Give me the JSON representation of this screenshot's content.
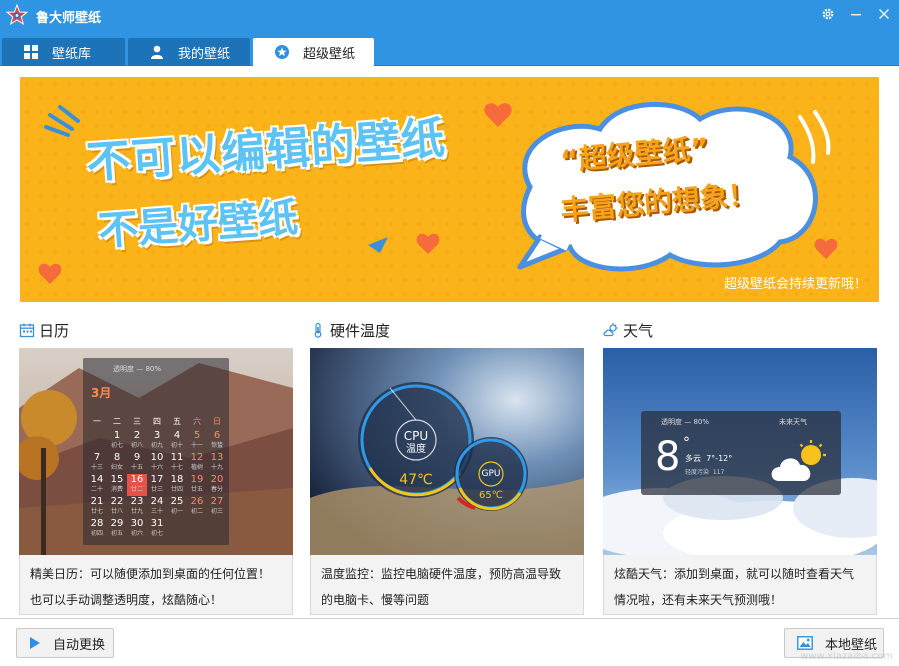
{
  "window": {
    "title": "鲁大师壁纸",
    "icons": {
      "logo": "star-logo-icon",
      "settings": "gear-icon",
      "minimize": "minimize-icon",
      "close": "close-icon"
    }
  },
  "tabs": [
    {
      "label": "壁纸库",
      "icon": "grid-icon",
      "active": false
    },
    {
      "label": "我的壁纸",
      "icon": "user-icon",
      "active": false
    },
    {
      "label": "超级壁纸",
      "icon": "star-badge-icon",
      "active": true
    }
  ],
  "banner": {
    "headline_1": "不可以编辑的壁纸",
    "headline_2": "不是好壁纸",
    "cloud_line_1": "“超级壁纸”",
    "cloud_line_2": "丰富您的想象！",
    "note": "超级壁纸会持续更新哦！",
    "colors": {
      "background": "#fbb31a",
      "headline": "#5dc2f4",
      "cloud_text": "#f6a21a"
    }
  },
  "cards": [
    {
      "title": "日历",
      "icon": "calendar-icon",
      "description_1": "精美日历：可以随便添加到桌面的任何位置！",
      "description_2": "也可以手动调整透明度，炫酷随心！",
      "preview": {
        "month": "3月",
        "toolbar": "透明度",
        "percent": "80%",
        "weekdays": [
          "一",
          "二",
          "三",
          "四",
          "五",
          "六",
          "日"
        ],
        "weeks": [
          [
            [
              "",
              ""
            ],
            [
              "1",
              "初七"
            ],
            [
              "2",
              "初八"
            ],
            [
              "3",
              "初九"
            ],
            [
              "4",
              "初十"
            ],
            [
              "5",
              "十一"
            ],
            [
              "6",
              "惊蛰"
            ]
          ],
          [
            [
              "7",
              "十三"
            ],
            [
              "8",
              "妇女"
            ],
            [
              "9",
              "十五"
            ],
            [
              "10",
              "十六"
            ],
            [
              "11",
              "十七"
            ],
            [
              "12",
              "植树"
            ],
            [
              "13",
              "十九"
            ]
          ],
          [
            [
              "14",
              "二十"
            ],
            [
              "15",
              "消费"
            ],
            [
              "16",
              "廿二"
            ],
            [
              "17",
              "廿三"
            ],
            [
              "18",
              "廿四"
            ],
            [
              "19",
              "廿五"
            ],
            [
              "20",
              "春分"
            ]
          ],
          [
            [
              "21",
              "廿七"
            ],
            [
              "22",
              "廿八"
            ],
            [
              "23",
              "廿九"
            ],
            [
              "24",
              "三十"
            ],
            [
              "25",
              "初一"
            ],
            [
              "26",
              "初二"
            ],
            [
              "27",
              "初三"
            ]
          ],
          [
            [
              "28",
              "初四"
            ],
            [
              "29",
              "初五"
            ],
            [
              "30",
              "初六"
            ],
            [
              "31",
              "初七"
            ],
            [
              "",
              ""
            ],
            [
              "",
              ""
            ],
            [
              "",
              ""
            ]
          ]
        ],
        "today": "16"
      }
    },
    {
      "title": "硬件温度",
      "icon": "thermometer-icon",
      "description_1": "温度监控：监控电脑硬件温度，预防高温导致",
      "description_2": "的电脑卡、慢等问题",
      "preview": {
        "cpu_label": "CPU",
        "cpu_sub": "温度",
        "cpu_temp": "47℃",
        "gpu_label": "GPU",
        "gpu_temp": "65℃"
      }
    },
    {
      "title": "天气",
      "icon": "weather-icon",
      "description_1": "炫酷天气：添加到桌面，就可以随时查看天气",
      "description_2": "情况啦，还有未来天气预测哦！",
      "preview": {
        "toolbar": "透明度",
        "percent": "80%",
        "future_label": "未来天气",
        "temp": "8",
        "unit": "°",
        "condition": "多云",
        "range": "7°-12°",
        "aqi_label": "轻度污染",
        "aqi": "117"
      }
    }
  ],
  "footer": {
    "auto_change_label": "自动更换",
    "auto_change_icon": "play-icon",
    "local_wallpaper_label": "本地壁纸",
    "local_wallpaper_icon": "image-icon",
    "watermark": "www.xiazaiba.com"
  }
}
